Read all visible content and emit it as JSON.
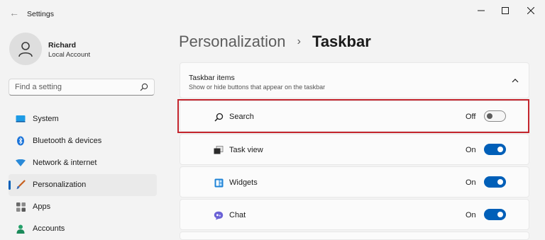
{
  "app": {
    "title": "Settings"
  },
  "user": {
    "name": "Richard",
    "account_type": "Local Account"
  },
  "search": {
    "placeholder": "Find a setting"
  },
  "nav": {
    "items": [
      {
        "label": "System",
        "icon": "system-icon",
        "selected": false
      },
      {
        "label": "Bluetooth & devices",
        "icon": "bluetooth-icon",
        "selected": false
      },
      {
        "label": "Network & internet",
        "icon": "wifi-icon",
        "selected": false
      },
      {
        "label": "Personalization",
        "icon": "brush-icon",
        "selected": true
      },
      {
        "label": "Apps",
        "icon": "apps-icon",
        "selected": false
      },
      {
        "label": "Accounts",
        "icon": "person-icon",
        "selected": false
      }
    ]
  },
  "breadcrumb": {
    "parent": "Personalization",
    "separator": "›",
    "current": "Taskbar"
  },
  "section": {
    "title": "Taskbar items",
    "subtitle": "Show or hide buttons that appear on the taskbar"
  },
  "taskbar_items": [
    {
      "label": "Search",
      "state": "Off",
      "on": false,
      "icon": "search-icon"
    },
    {
      "label": "Task view",
      "state": "On",
      "on": true,
      "icon": "task-view-icon"
    },
    {
      "label": "Widgets",
      "state": "On",
      "on": true,
      "icon": "widgets-icon"
    },
    {
      "label": "Chat",
      "state": "On",
      "on": true,
      "icon": "chat-icon"
    }
  ],
  "colors": {
    "accent": "#005fb8",
    "highlight": "#c4262e",
    "background": "#f3f3f3",
    "card": "#fbfbfb"
  }
}
